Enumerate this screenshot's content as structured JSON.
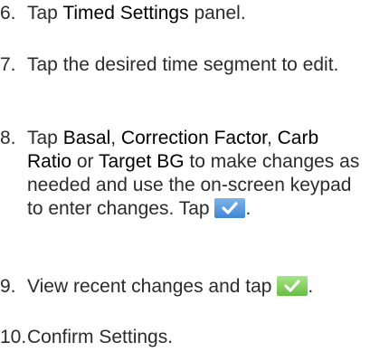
{
  "steps": [
    {
      "num": "6.",
      "pre": "Tap ",
      "kw1": "Timed Settings",
      "post": " panel."
    },
    {
      "num": "7.",
      "text": "Tap the desired time segment to edit."
    },
    {
      "num": "8.",
      "pre": "Tap ",
      "kw1": "Basal",
      "sep1": ", ",
      "kw2": "Correction Factor",
      "sep2": ", ",
      "kw3": "Carb Ratio",
      "sep3": " or ",
      "kw4": "Target BG",
      "post": " to make changes as needed and use the on-screen keypad to enter changes. Tap ",
      "end": ".",
      "icon": "checkmark-button-blue-icon"
    },
    {
      "num": "9.",
      "pre": "View recent changes and tap ",
      "end": ".",
      "icon": "checkmark-button-green-icon"
    },
    {
      "num": "10.",
      "text": "Confirm Settings."
    }
  ],
  "colors": {
    "text": "#2b2b2b",
    "confirm_blue": "#4a8fdc",
    "confirm_green": "#6cc444"
  }
}
